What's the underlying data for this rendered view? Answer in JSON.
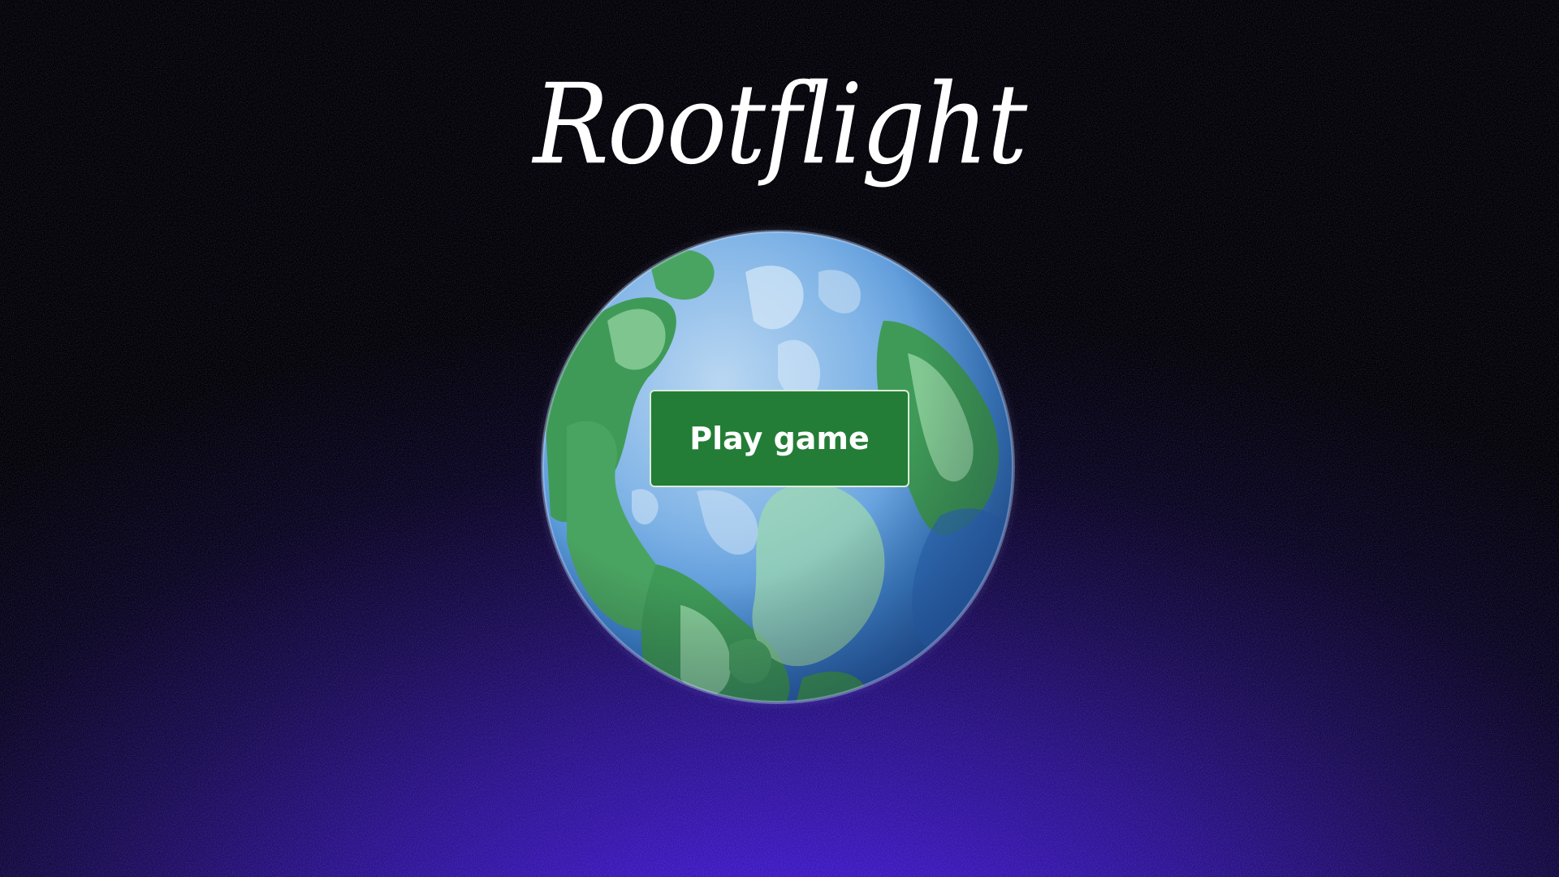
{
  "game": {
    "title": "Rootflight"
  },
  "menu": {
    "play_label": "Play game"
  },
  "colors": {
    "button_green": "#237d36",
    "ocean_blue": "#4f8fd8",
    "land_green": "#3f9a58",
    "space_purple": "#4b1de8"
  },
  "icons": {
    "planet": "planet-globe-icon"
  }
}
